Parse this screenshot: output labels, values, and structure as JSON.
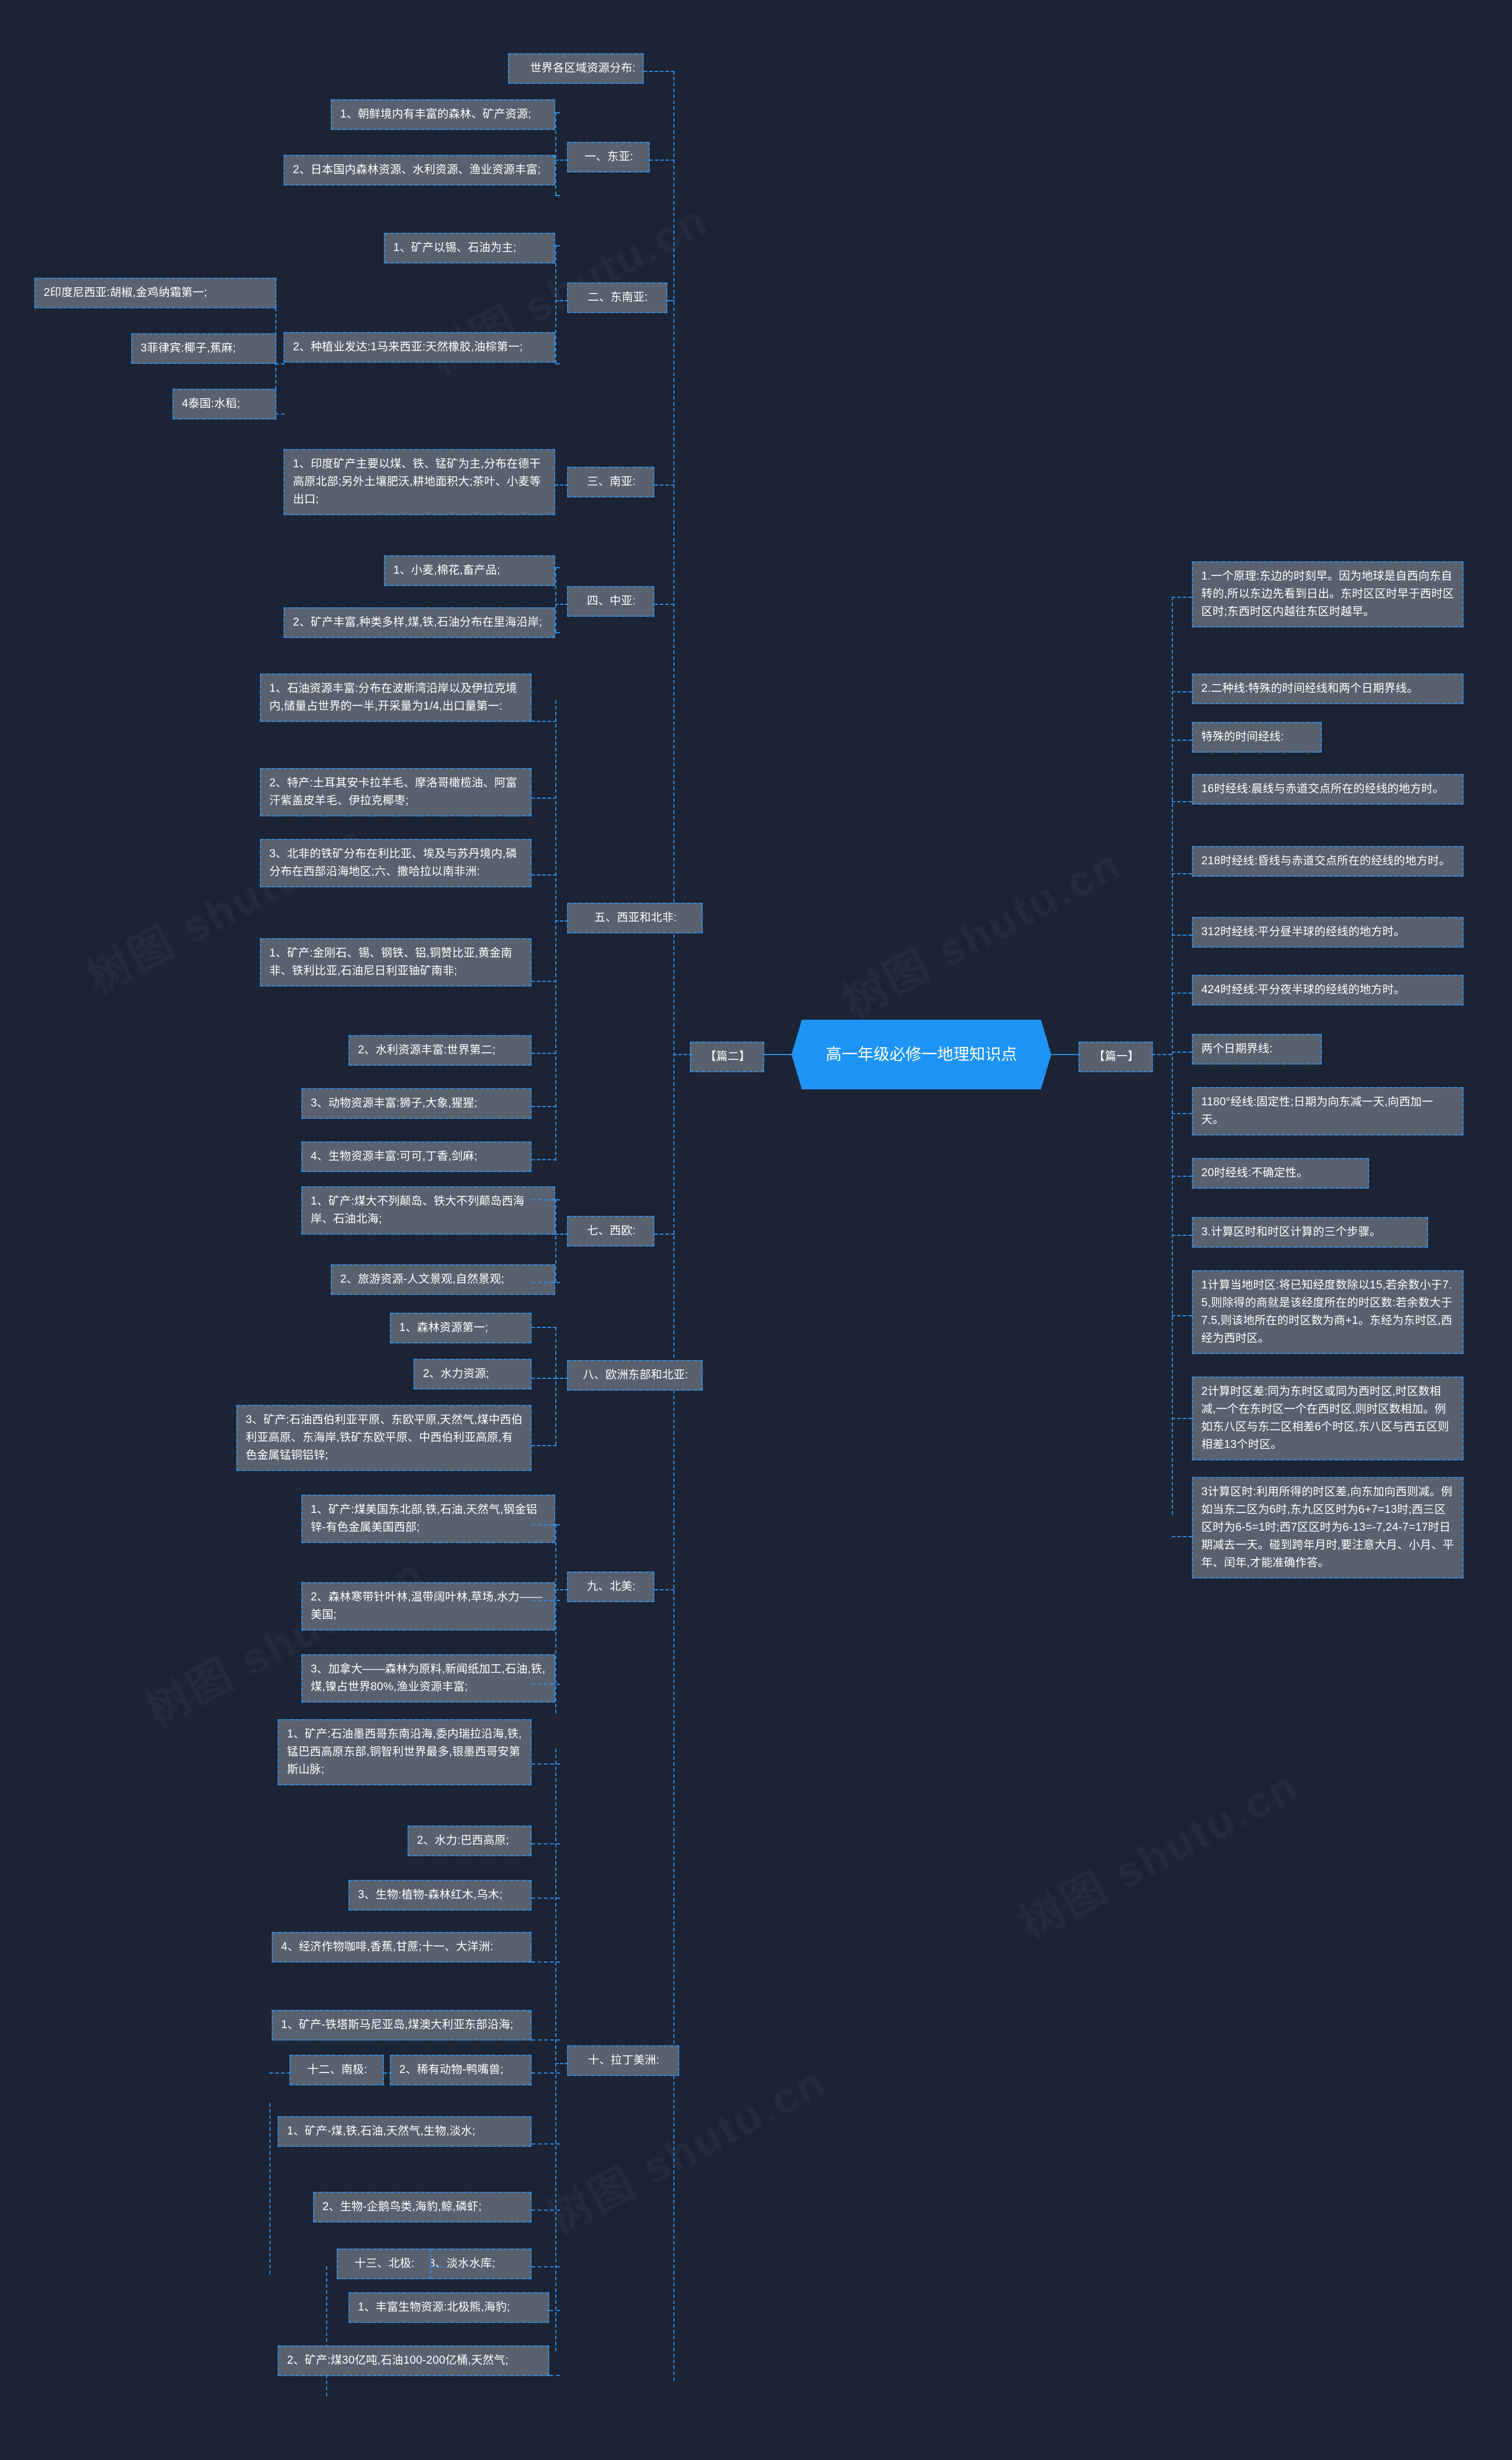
{
  "theme": {
    "background": "#1b2334",
    "node_fill": "#59616e",
    "node_border": "#2f8ae0",
    "central_fill": "#1d94f5",
    "text": "#ffffff"
  },
  "watermark": "树图 shutu.cn",
  "central": {
    "title": "高一年级必修一地理知识点"
  },
  "branches": {
    "left": {
      "label": "【篇二】"
    },
    "right": {
      "label": "【篇一】"
    }
  },
  "left_root": {
    "label": "世界各区域资源分布:"
  },
  "left_sections": [
    {
      "title": "一、东亚:",
      "items": [
        "1、朝鲜境内有丰富的森林、矿产资源;",
        "2、日本国内森林资源、水利资源、渔业资源丰富;"
      ]
    },
    {
      "title": "二、东南亚:",
      "items": [
        "1、矿产以锡、石油为主;",
        "2、种植业发达:1马来西亚:天然橡胶,油棕第一;"
      ],
      "subitems": [
        "2印度尼西亚:胡椒,金鸡纳霜第一;",
        "3菲律宾:椰子,蕉麻;",
        "4泰国:水稻;"
      ]
    },
    {
      "title": "三、南亚:",
      "items": [
        "1、印度矿产主要以煤、铁、锰矿为主,分布在德干高原北部;另外土壤肥沃,耕地面积大;茶叶、小麦等出口;"
      ]
    },
    {
      "title": "四、中亚:",
      "items": [
        "1、小麦,棉花,畜产品;",
        "2、矿产丰富,种类多样,煤,铁,石油分布在里海沿岸;"
      ]
    },
    {
      "title": "五、西亚和北非:",
      "items": [
        "1、石油资源丰富:分布在波斯湾沿岸以及伊拉克境内,储量占世界的一半,开采量为1/4,出口量第一:",
        "2、特产:土耳其安卡拉羊毛、摩洛哥橄榄油、阿富汗紫盖皮羊毛、伊拉克椰枣;",
        "3、北非的铁矿分布在利比亚、埃及与苏丹境内,磷分布在西部沿海地区;六、撒哈拉以南非洲:",
        "1、矿产:金刚石、锡、钢铁、铝,铜赞比亚,黄金南非、铁利比亚,石油尼日利亚铀矿南非;",
        "2、水利资源丰富:世界第二;",
        "3、动物资源丰富:狮子,大象,猩猩;",
        "4、生物资源丰富:可可,丁香,剑麻;"
      ]
    },
    {
      "title": "七、西欧:",
      "items": [
        "1、矿产:煤大不列颠岛、铁大不列颠岛西海岸、石油北海;",
        "2、旅游资源-人文景观,自然景观;"
      ]
    },
    {
      "title": "八、欧洲东部和北亚:",
      "items": [
        "1、森林资源第一;",
        "2、水力资源;",
        "3、矿产:石油西伯利亚平原、东欧平原,天然气,煤中西伯利亚高原、东海岸,铁矿东欧平原、中西伯利亚高原,有色金属锰铜铝锌;"
      ]
    },
    {
      "title": "九、北美:",
      "items": [
        "1、矿产:煤美国东北部,铁,石油,天然气,钢金铝锌-有色金属美国西部;",
        "2、森林寒带针叶林,温带阔叶林,草场,水力——美国;",
        "3、加拿大——森林为原料,新闻纸加工,石油,铁,煤,镍占世界80%,渔业资源丰富;"
      ]
    },
    {
      "title": "十、拉丁美洲:",
      "items": [
        "1、矿产:石油墨西哥东南沿海,委内瑞拉沿海,铁,锰巴西高原东部,铜智利世界最多,银墨西哥安第斯山脉;",
        "2、水力:巴西高原;",
        "3、生物:植物-森林红木,乌木;",
        "4、经济作物咖啡,香蕉,甘蔗;十一、大洋洲:",
        "1、矿产-铁塔斯马尼亚岛,煤澳大利亚东部沿海;",
        "2、稀有动物-鸭嘴兽;"
      ]
    },
    {
      "title": "十二、南极:",
      "items": [
        "1、矿产-煤,铁,石油,天然气,生物,淡水;",
        "2、生物-企鹅鸟类,海豹,鲸,磷虾;",
        "3、淡水水库;"
      ]
    },
    {
      "title": "十三、北极:",
      "items": [
        "1、丰富生物资源:北极熊,海豹;",
        "2、矿产:煤30亿吨,石油100-200亿桶,天然气;"
      ]
    }
  ],
  "right_items": [
    "1.一个原理:东边的时刻早。因为地球是自西向东自转的,所以东边先看到日出。东时区区时早于西时区区时;东西时区内越往东区时越早。",
    "2.二种线:特殊的时间经线和两个日期界线。",
    "特殊的时间经线:",
    "16时经线:晨线与赤道交点所在的经线的地方时。",
    "218时经线:昏线与赤道交点所在的经线的地方时。",
    "312时经线:平分昼半球的经线的地方时。",
    "424时经线:平分夜半球的经线的地方时。",
    "两个日期界线:",
    "1180°经线:固定性;日期为向东减一天,向西加一天。",
    "20时经线:不确定性。",
    "3.计算区时和时区计算的三个步骤。",
    "1计算当地时区:将已知经度数除以15,若余数小于7.5,则除得的商就是该经度所在的时区数:若余数大于7.5,则该地所在的时区数为商+1。东经为东时区,西经为西时区。",
    "2计算时区差:同为东时区或同为西时区,时区数相减,一个在东时区一个在西时区,则时区数相加。例如东八区与东二区相差6个时区,东八区与西五区则相差13个时区。",
    "3计算区时:利用所得的时区差,向东加向西则减。例如当东二区为6时,东九区区时为6+7=13时;西三区区时为6-5=1时;西7区区时为6-13=-7,24-7=17时日期减去一天。碰到跨年月时,要注意大月、小月、平年、闰年,才能准确作答。"
  ]
}
